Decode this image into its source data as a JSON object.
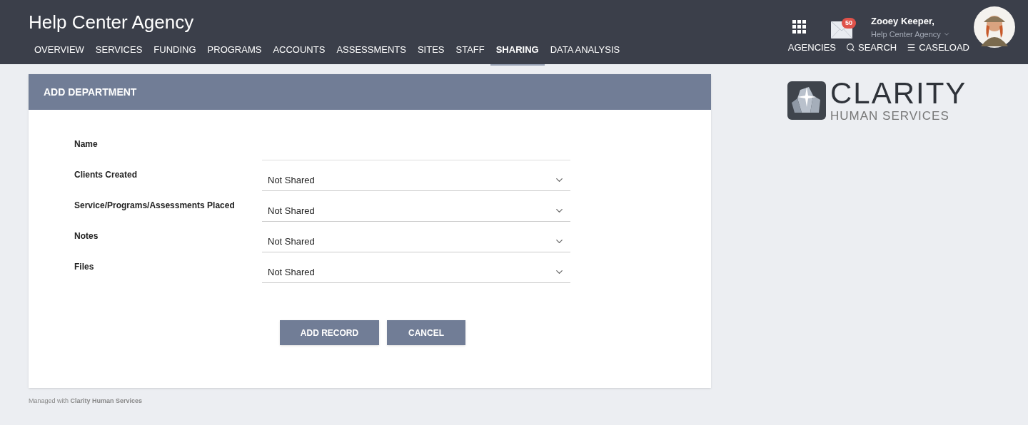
{
  "header": {
    "title": "Help Center Agency",
    "notifications": "50",
    "user_name": "Zooey Keeper,",
    "user_agency": "Help Center Agency"
  },
  "nav": [
    {
      "label": "OVERVIEW",
      "selected": false
    },
    {
      "label": "SERVICES",
      "selected": false
    },
    {
      "label": "FUNDING",
      "selected": false
    },
    {
      "label": "PROGRAMS",
      "selected": false
    },
    {
      "label": "ACCOUNTS",
      "selected": false
    },
    {
      "label": "ASSESSMENTS",
      "selected": false
    },
    {
      "label": "SITES",
      "selected": false
    },
    {
      "label": "STAFF",
      "selected": false
    },
    {
      "label": "SHARING",
      "selected": true
    },
    {
      "label": "DATA ANALYSIS",
      "selected": false
    }
  ],
  "nav_right": [
    {
      "label": "AGENCIES",
      "kind": "plain"
    },
    {
      "label": "SEARCH",
      "kind": "search"
    },
    {
      "label": "CASELOAD",
      "kind": "menu"
    }
  ],
  "form": {
    "title": "ADD DEPARTMENT",
    "fields": [
      {
        "label": "Name",
        "kind": "text"
      },
      {
        "label": "Clients Created",
        "kind": "select",
        "value": "Not Shared"
      },
      {
        "label": "Service/Programs/Assessments Placed",
        "kind": "select",
        "value": "Not Shared"
      },
      {
        "label": "Notes",
        "kind": "select",
        "value": "Not Shared"
      },
      {
        "label": "Files",
        "kind": "select",
        "value": "Not Shared"
      }
    ],
    "buttons": [
      "ADD RECORD",
      "CANCEL"
    ]
  },
  "logo": {
    "name": "CLARITY",
    "tagline": "HUMAN SERVICES"
  },
  "footer": "Managed with **Clarity Human Services**"
}
